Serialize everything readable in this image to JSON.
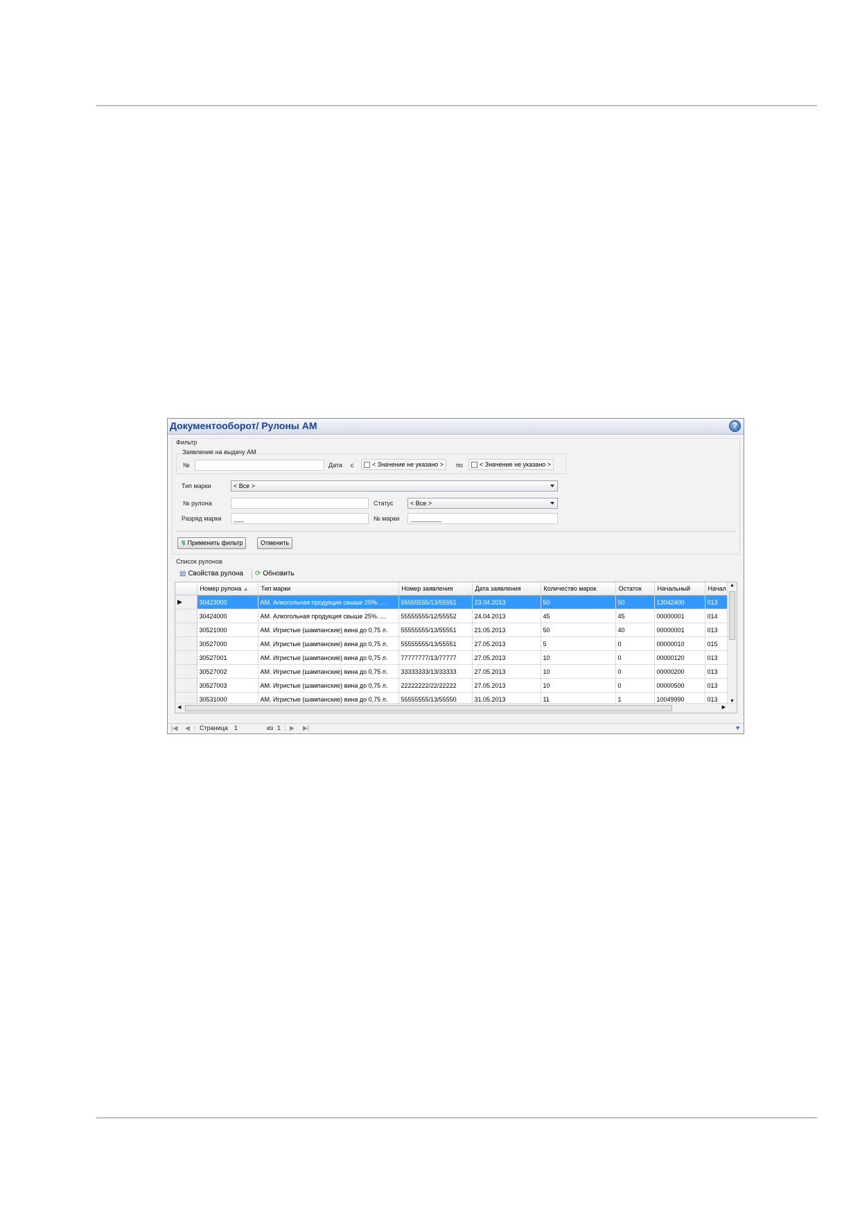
{
  "window": {
    "title": "Документооборот/ Рулоны АМ",
    "help_label": "?"
  },
  "filter": {
    "legend": "Фильтр",
    "application_legend": "Заявление на выдачу АМ",
    "number_label": "№",
    "number_value": "",
    "date_label": "Дата",
    "from_label": "с",
    "to_label": "по",
    "date_from": "< Значение не указано >",
    "date_to": "< Значение не указано >",
    "mark_type_label": "Тип марки",
    "mark_type_value": "< Все >",
    "roll_number_label": "№ рулона",
    "roll_number_value": "",
    "status_label": "Статус",
    "status_value": "< Все >",
    "mark_digit_label": "Разряд марки",
    "mark_digit_mask": "___",
    "mark_number_label": "№ марки",
    "mark_number_mask": "_________",
    "apply_label": "Применить фильтр",
    "cancel_label": "Отменить"
  },
  "list": {
    "legend": "Список рулонов",
    "props_label": "Свойства рулона",
    "refresh_label": "Обновить"
  },
  "grid": {
    "columns": [
      "Номер рулона",
      "Тип марки",
      "Номер заявления",
      "Дата заявления",
      "Количество марок",
      "Остаток",
      "Начальный",
      "Начал"
    ],
    "rows": [
      [
        "30423000",
        "АМ. Алкогольная продукция свыше 25%. ...",
        "55555555/13/55551",
        "23.04.2013",
        "50",
        "50",
        "13042400",
        "013"
      ],
      [
        "30424000",
        "АМ. Алкогольная продукция свыше 25%. ...",
        "55555555/12/55552",
        "24.04.2013",
        "45",
        "45",
        "00000001",
        "014"
      ],
      [
        "30521000",
        "АМ. Игристые (шампанские) вина до 0,75 л.",
        "55555555/13/55551",
        "21.05.2013",
        "50",
        "40",
        "00000001",
        "013"
      ],
      [
        "30527000",
        "АМ. Игристые (шампанские) вина до 0,75 л.",
        "55555555/13/55551",
        "27.05.2013",
        "5",
        "0",
        "00000010",
        "015"
      ],
      [
        "30527001",
        "АМ. Игристые (шампанские) вина до 0,75 л.",
        "77777777/13/77777",
        "27.05.2013",
        "10",
        "0",
        "00000120",
        "013"
      ],
      [
        "30527002",
        "АМ. Игристые (шампанские) вина до 0,75 л.",
        "33333333/13/33333",
        "27.05.2013",
        "10",
        "0",
        "00000200",
        "013"
      ],
      [
        "30527003",
        "АМ. Игристые (шампанские) вина до 0,75 л.",
        "22222222/22/22222",
        "27.05.2013",
        "10",
        "0",
        "00000500",
        "013"
      ],
      [
        "30531000",
        "АМ. Игристые (шампанские) вина до 0,75 л.",
        "55555555/13/55550",
        "31.05.2013",
        "11",
        "1",
        "10049990",
        "013"
      ]
    ]
  },
  "pager": {
    "page_label": "Страница",
    "page_value": "1",
    "of_label": "из",
    "total_pages": "1"
  }
}
